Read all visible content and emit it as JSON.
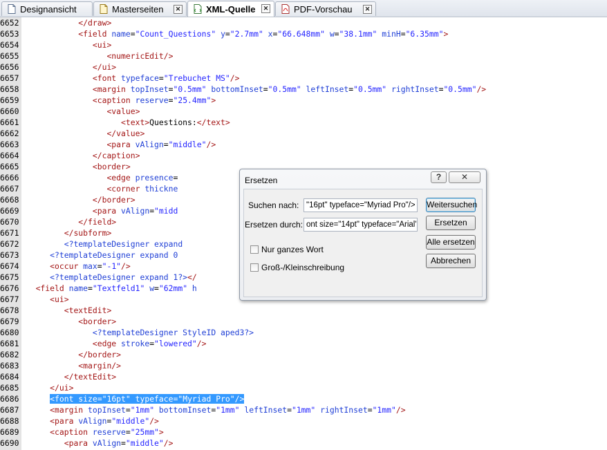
{
  "tabs": [
    {
      "label": "Designansicht",
      "icon": "page-icon",
      "closable": false,
      "active": false
    },
    {
      "label": "Masterseiten",
      "icon": "master-page-icon",
      "closable": true,
      "active": false
    },
    {
      "label": "XML-Quelle",
      "icon": "xml-icon",
      "closable": true,
      "active": true
    },
    {
      "label": "PDF-Vorschau",
      "icon": "pdf-icon",
      "closable": true,
      "active": false
    }
  ],
  "close_glyph": "✕",
  "lines": [
    {
      "n": "6652",
      "indent": "            ",
      "parts": [
        [
          "t",
          "</draw>"
        ]
      ]
    },
    {
      "n": "6653",
      "indent": "            ",
      "parts": [
        [
          "t",
          "<field "
        ],
        [
          "a",
          "name"
        ],
        [
          "x",
          "="
        ],
        [
          "v",
          "\"Count_Questions\""
        ],
        [
          "x",
          " "
        ],
        [
          "a",
          "y"
        ],
        [
          "x",
          "="
        ],
        [
          "v",
          "\"2.7mm\""
        ],
        [
          "x",
          " "
        ],
        [
          "a",
          "x"
        ],
        [
          "x",
          "="
        ],
        [
          "v",
          "\"66.648mm\""
        ],
        [
          "x",
          " "
        ],
        [
          "a",
          "w"
        ],
        [
          "x",
          "="
        ],
        [
          "v",
          "\"38.1mm\""
        ],
        [
          "x",
          " "
        ],
        [
          "a",
          "minH"
        ],
        [
          "x",
          "="
        ],
        [
          "v",
          "\"6.35mm\""
        ],
        [
          "t",
          ">"
        ]
      ]
    },
    {
      "n": "6654",
      "indent": "               ",
      "parts": [
        [
          "t",
          "<ui>"
        ]
      ]
    },
    {
      "n": "6655",
      "indent": "                  ",
      "parts": [
        [
          "t",
          "<numericEdit/>"
        ]
      ]
    },
    {
      "n": "6656",
      "indent": "               ",
      "parts": [
        [
          "t",
          "</ui>"
        ]
      ]
    },
    {
      "n": "6657",
      "indent": "               ",
      "parts": [
        [
          "t",
          "<font "
        ],
        [
          "a",
          "typeface"
        ],
        [
          "x",
          "="
        ],
        [
          "v",
          "\"Trebuchet MS\""
        ],
        [
          "t",
          "/>"
        ]
      ]
    },
    {
      "n": "6658",
      "indent": "               ",
      "parts": [
        [
          "t",
          "<margin "
        ],
        [
          "a",
          "topInset"
        ],
        [
          "x",
          "="
        ],
        [
          "v",
          "\"0.5mm\""
        ],
        [
          "x",
          " "
        ],
        [
          "a",
          "bottomInset"
        ],
        [
          "x",
          "="
        ],
        [
          "v",
          "\"0.5mm\""
        ],
        [
          "x",
          " "
        ],
        [
          "a",
          "leftInset"
        ],
        [
          "x",
          "="
        ],
        [
          "v",
          "\"0.5mm\""
        ],
        [
          "x",
          " "
        ],
        [
          "a",
          "rightInset"
        ],
        [
          "x",
          "="
        ],
        [
          "v",
          "\"0.5mm\""
        ],
        [
          "t",
          "/>"
        ]
      ]
    },
    {
      "n": "6659",
      "indent": "               ",
      "parts": [
        [
          "t",
          "<caption "
        ],
        [
          "a",
          "reserve"
        ],
        [
          "x",
          "="
        ],
        [
          "v",
          "\"25.4mm\""
        ],
        [
          "t",
          ">"
        ]
      ]
    },
    {
      "n": "6660",
      "indent": "                  ",
      "parts": [
        [
          "t",
          "<value>"
        ]
      ]
    },
    {
      "n": "6661",
      "indent": "                     ",
      "parts": [
        [
          "t",
          "<text>"
        ],
        [
          "x",
          "Questions:"
        ],
        [
          "t",
          "</text>"
        ]
      ]
    },
    {
      "n": "6662",
      "indent": "                  ",
      "parts": [
        [
          "t",
          "</value>"
        ]
      ]
    },
    {
      "n": "6663",
      "indent": "                  ",
      "parts": [
        [
          "t",
          "<para "
        ],
        [
          "a",
          "vAlign"
        ],
        [
          "x",
          "="
        ],
        [
          "v",
          "\"middle\""
        ],
        [
          "t",
          "/>"
        ]
      ]
    },
    {
      "n": "6664",
      "indent": "               ",
      "parts": [
        [
          "t",
          "</caption>"
        ]
      ]
    },
    {
      "n": "6665",
      "indent": "               ",
      "parts": [
        [
          "t",
          "<border>"
        ]
      ]
    },
    {
      "n": "6666",
      "indent": "                  ",
      "parts": [
        [
          "t",
          "<edge "
        ],
        [
          "a",
          "presence"
        ],
        [
          "x",
          "="
        ]
      ]
    },
    {
      "n": "6667",
      "indent": "                  ",
      "parts": [
        [
          "t",
          "<corner "
        ],
        [
          "a",
          "thickne"
        ]
      ]
    },
    {
      "n": "6668",
      "indent": "               ",
      "parts": [
        [
          "t",
          "</border>"
        ]
      ]
    },
    {
      "n": "6669",
      "indent": "               ",
      "parts": [
        [
          "t",
          "<para "
        ],
        [
          "a",
          "vAlign"
        ],
        [
          "x",
          "="
        ],
        [
          "v",
          "\"midd"
        ]
      ]
    },
    {
      "n": "6670",
      "indent": "            ",
      "parts": [
        [
          "t",
          "</field>"
        ]
      ]
    },
    {
      "n": "6671",
      "indent": "         ",
      "parts": [
        [
          "t",
          "</subform>"
        ]
      ]
    },
    {
      "n": "6672",
      "indent": "         ",
      "parts": [
        [
          "p",
          "<?templateDesigner expand"
        ]
      ]
    },
    {
      "n": "6673",
      "indent": "      ",
      "parts": [
        [
          "p",
          "<?templateDesigner expand 0"
        ]
      ]
    },
    {
      "n": "6674",
      "indent": "      ",
      "parts": [
        [
          "t",
          "<occur "
        ],
        [
          "a",
          "max"
        ],
        [
          "x",
          "="
        ],
        [
          "v",
          "\"-1\""
        ],
        [
          "t",
          "/>"
        ]
      ]
    },
    {
      "n": "6675",
      "indent": "      ",
      "parts": [
        [
          "p",
          "<?templateDesigner expand 1?>"
        ],
        [
          "t",
          "</"
        ]
      ]
    },
    {
      "n": "6676",
      "indent": "   ",
      "parts": [
        [
          "t",
          "<field "
        ],
        [
          "a",
          "name"
        ],
        [
          "x",
          "="
        ],
        [
          "v",
          "\"Textfeld1\""
        ],
        [
          "x",
          " "
        ],
        [
          "a",
          "w"
        ],
        [
          "x",
          "="
        ],
        [
          "v",
          "\"62mm\""
        ],
        [
          "x",
          " "
        ],
        [
          "a",
          "h"
        ]
      ]
    },
    {
      "n": "6677",
      "indent": "      ",
      "parts": [
        [
          "t",
          "<ui>"
        ]
      ]
    },
    {
      "n": "6678",
      "indent": "         ",
      "parts": [
        [
          "t",
          "<textEdit>"
        ]
      ]
    },
    {
      "n": "6679",
      "indent": "            ",
      "parts": [
        [
          "t",
          "<border>"
        ]
      ]
    },
    {
      "n": "6680",
      "indent": "               ",
      "parts": [
        [
          "p",
          "<?templateDesigner StyleID aped3?>"
        ]
      ]
    },
    {
      "n": "6681",
      "indent": "               ",
      "parts": [
        [
          "t",
          "<edge "
        ],
        [
          "a",
          "stroke"
        ],
        [
          "x",
          "="
        ],
        [
          "v",
          "\"lowered\""
        ],
        [
          "t",
          "/>"
        ]
      ]
    },
    {
      "n": "6682",
      "indent": "            ",
      "parts": [
        [
          "t",
          "</border>"
        ]
      ]
    },
    {
      "n": "6683",
      "indent": "            ",
      "parts": [
        [
          "t",
          "<margin/>"
        ]
      ]
    },
    {
      "n": "6684",
      "indent": "         ",
      "parts": [
        [
          "t",
          "</textEdit>"
        ]
      ]
    },
    {
      "n": "6685",
      "indent": "      ",
      "parts": [
        [
          "t",
          "</ui>"
        ]
      ]
    },
    {
      "n": "6686",
      "indent": "      ",
      "selected": true,
      "parts": [
        [
          "t",
          "<font "
        ],
        [
          "a",
          "size"
        ],
        [
          "x",
          "="
        ],
        [
          "v",
          "\"16pt\""
        ],
        [
          "x",
          " "
        ],
        [
          "a",
          "typeface"
        ],
        [
          "x",
          "="
        ],
        [
          "v",
          "\"Myriad Pro\""
        ],
        [
          "t",
          "/>"
        ]
      ]
    },
    {
      "n": "6687",
      "indent": "      ",
      "parts": [
        [
          "t",
          "<margin "
        ],
        [
          "a",
          "topInset"
        ],
        [
          "x",
          "="
        ],
        [
          "v",
          "\"1mm\""
        ],
        [
          "x",
          " "
        ],
        [
          "a",
          "bottomInset"
        ],
        [
          "x",
          "="
        ],
        [
          "v",
          "\"1mm\""
        ],
        [
          "x",
          " "
        ],
        [
          "a",
          "leftInset"
        ],
        [
          "x",
          "="
        ],
        [
          "v",
          "\"1mm\""
        ],
        [
          "x",
          " "
        ],
        [
          "a",
          "rightInset"
        ],
        [
          "x",
          "="
        ],
        [
          "v",
          "\"1mm\""
        ],
        [
          "t",
          "/>"
        ]
      ]
    },
    {
      "n": "6688",
      "indent": "      ",
      "parts": [
        [
          "t",
          "<para "
        ],
        [
          "a",
          "vAlign"
        ],
        [
          "x",
          "="
        ],
        [
          "v",
          "\"middle\""
        ],
        [
          "t",
          "/>"
        ]
      ]
    },
    {
      "n": "6689",
      "indent": "      ",
      "parts": [
        [
          "t",
          "<caption "
        ],
        [
          "a",
          "reserve"
        ],
        [
          "x",
          "="
        ],
        [
          "v",
          "\"25mm\""
        ],
        [
          "t",
          ">"
        ]
      ]
    },
    {
      "n": "6690",
      "indent": "         ",
      "parts": [
        [
          "t",
          "<para "
        ],
        [
          "a",
          "vAlign"
        ],
        [
          "x",
          "="
        ],
        [
          "v",
          "\"middle\""
        ],
        [
          "t",
          "/>"
        ]
      ]
    }
  ],
  "dialog": {
    "title": "Ersetzen",
    "help_label": "?",
    "close_label": "✕",
    "search_label": "Suchen nach:",
    "search_value": "\"16pt\" typeface=\"Myriad Pro\"/>",
    "replace_label": "Ersetzen durch:",
    "replace_value": "ont size=\"14pt\" typeface=\"Arial\"",
    "whole_word_label": "Nur ganzes Wort",
    "whole_word_checked": false,
    "match_case_label": "Groß-/Kleinschreibung",
    "match_case_checked": false,
    "buttons": {
      "find_next": "Weitersuchen",
      "replace": "Ersetzen",
      "replace_all": "Alle ersetzen",
      "cancel": "Abbrechen"
    }
  },
  "colors": {
    "tag": "#a31515",
    "attribute": "#1f3fd6",
    "value": "#2424ff",
    "selection": "#3399ff",
    "gutter": "#e4e4e4"
  }
}
